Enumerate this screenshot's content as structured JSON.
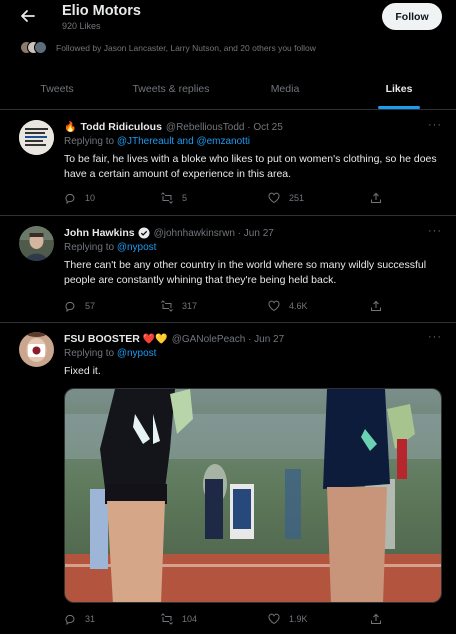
{
  "header": {
    "title": "Elio Motors",
    "subtitle": "920 Likes",
    "follow_label": "Follow"
  },
  "followed_by": "Followed by Jason Lancaster, Larry Nutson, and 20 others you follow",
  "tabs": [
    {
      "label": "Tweets",
      "active": false
    },
    {
      "label": "Tweets & replies",
      "active": false
    },
    {
      "label": "Media",
      "active": false
    },
    {
      "label": "Likes",
      "active": true
    }
  ],
  "tweets": [
    {
      "name": "Todd Ridiculous",
      "emoji": "🔥",
      "meta": "@RebelliousTodd · Oct 25",
      "reply_prefix": "Replying to ",
      "reply_to": "@JThereault and @emzanotti",
      "text": "To be fair, he lives with a bloke who likes to put on women's clothing, so he does have a certain amount of experience in this area.",
      "replies": "10",
      "retweets": "5",
      "likes": "251"
    },
    {
      "name": "John Hawkins",
      "verified": true,
      "meta": "@johnhawkinsrwn · Jun 27",
      "reply_prefix": "Replying to ",
      "reply_to": "@nypost",
      "text": "There can't be any other country in the world where so many wildly successful people are constantly whining that they're being held back.",
      "replies": "57",
      "retweets": "317",
      "likes": "4.6K"
    },
    {
      "name": "FSU BOOSTER",
      "hearts": "❤️💛",
      "meta": "@GANolePeach · Jun 27",
      "reply_prefix": "Replying to ",
      "reply_to": "@nypost",
      "text": "Fixed it.",
      "replies": "31",
      "retweets": "104",
      "likes": "1.9K"
    }
  ],
  "more_label": "···",
  "colors": {
    "accent": "#1d9bf0",
    "muted": "#71767b",
    "border": "#2f3336"
  }
}
